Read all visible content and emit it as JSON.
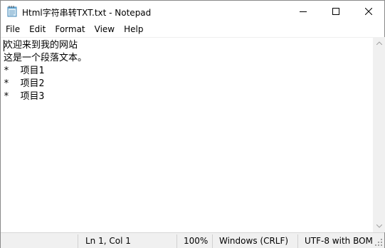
{
  "window": {
    "title": "Html字符串转TXT.txt - Notepad"
  },
  "menu": {
    "items": [
      {
        "label": "File"
      },
      {
        "label": "Edit"
      },
      {
        "label": "Format"
      },
      {
        "label": "View"
      },
      {
        "label": "Help"
      }
    ]
  },
  "editor": {
    "content": "欢迎来到我的网站\n这是一个段落文本。\n*  项目1\n*  项目2\n*  项目3"
  },
  "statusbar": {
    "position": "Ln 1, Col 1",
    "zoom": "100%",
    "line_ending": "Windows (CRLF)",
    "encoding": "UTF-8 with BOM"
  },
  "icons": {
    "app": "notepad-icon",
    "minimize": "minimize-icon",
    "maximize": "maximize-icon",
    "close": "close-icon",
    "scroll_up": "scroll-up-arrow-icon",
    "scroll_down": "scroll-down-arrow-icon",
    "grip": "resize-grip-icon"
  }
}
